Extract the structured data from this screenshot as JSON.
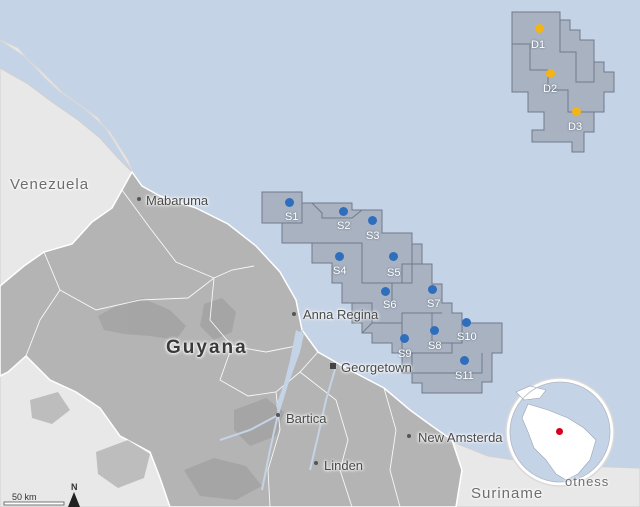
{
  "colors": {
    "sea": "#c5d3e6",
    "land_foreign": "#e8e8e8",
    "land_guyana": "#b4b4b4",
    "relief": "#9a9a9a",
    "block_fill": "#a8b2c1",
    "block_stroke": "#6f7a8c",
    "stabroek_dot": "#2f6ebd",
    "discovery_dot": "#f2b417",
    "locator_highlight": "#d0021b"
  },
  "countries": {
    "venezuela": "Venezuela",
    "guyana": "Guyana",
    "suriname": "Suriname",
    "cut_off_label": "otness"
  },
  "towns": {
    "mabaruma": "Mabaruma",
    "anna_regina": "Anna Regina",
    "georgetown": "Georgetown",
    "bartica": "Bartica",
    "linden": "Linden",
    "new_amsterdam": "New Amsterda"
  },
  "stabroek_blocks": [
    "S1",
    "S2",
    "S3",
    "S4",
    "S5",
    "S6",
    "S7",
    "S8",
    "S9",
    "S10",
    "S11"
  ],
  "discovery_blocks": [
    "D1",
    "D2",
    "D3"
  ],
  "scale_bar": {
    "label": "50 km"
  },
  "north_arrow": {
    "label": "N"
  }
}
